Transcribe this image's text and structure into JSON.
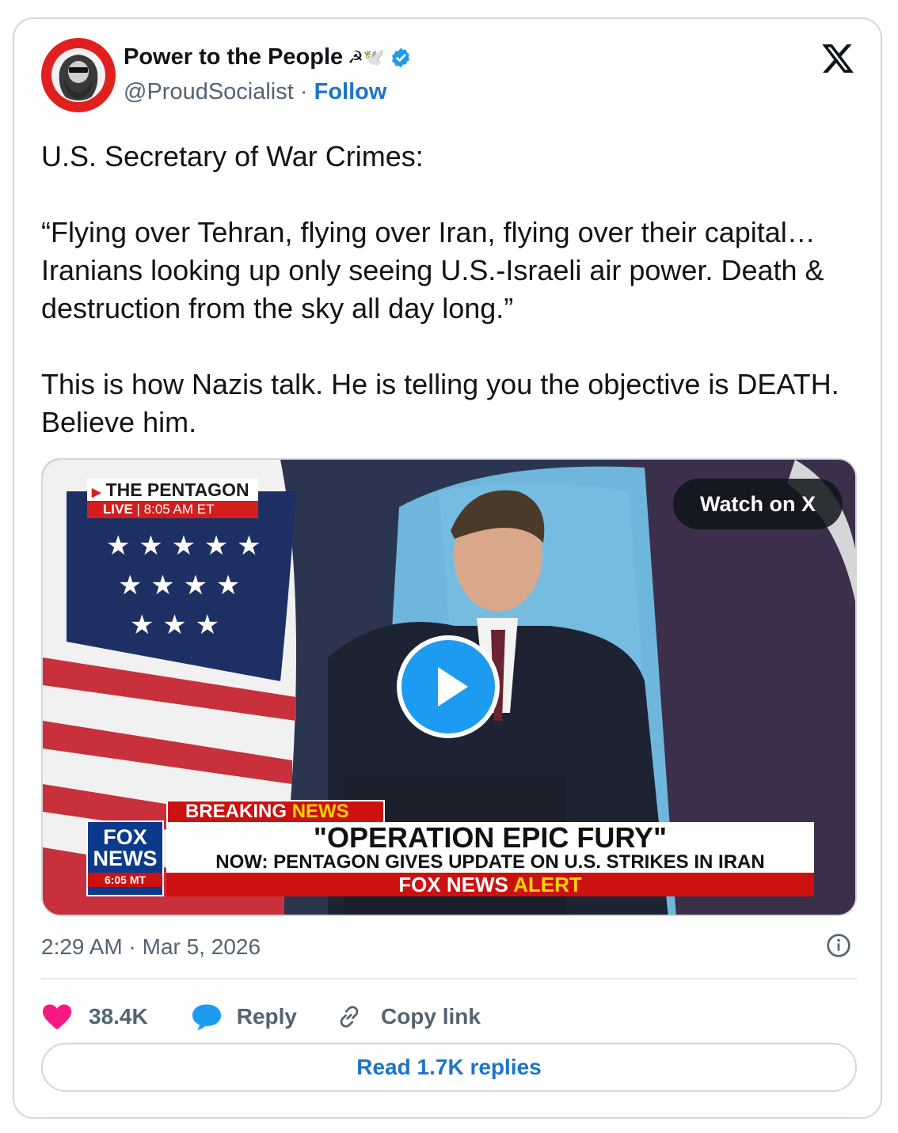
{
  "author": {
    "display_name": "Power to the People",
    "name_emoji": "☭🕊️",
    "verified": true,
    "handle": "@ProudSocialist",
    "separator": "·",
    "follow_label": "Follow"
  },
  "post": {
    "paragraphs": [
      "U.S. Secretary of War Crimes:",
      "“Flying over Tehran, flying over Iran, flying over their capital…Iranians looking up only seeing U.S.-Israeli air power. Death & destruction from the sky all day long.”",
      "This is how Nazis talk. He is telling you the objective is DEATH. Believe him."
    ],
    "timestamp": "2:29 AM · Mar 5, 2026"
  },
  "video": {
    "watch_label": "Watch on X",
    "chyron": {
      "source": "THE PENTAGON",
      "live": "LIVE",
      "live_time": "8:05 AM ET",
      "network_top": "FOX",
      "network_bottom": "NEWS",
      "network_time": "6:05 MT",
      "breaking": "BREAKING",
      "breaking_news": "NEWS",
      "headline": "\"OPERATION EPIC FURY\"",
      "subheadline": "NOW: PENTAGON GIVES UPDATE ON U.S. STRIKES IN IRAN",
      "alert_fox": "FOX NEWS",
      "alert_word": "ALERT"
    }
  },
  "actions": {
    "likes": "38.4K",
    "reply_label": "Reply",
    "copy_link_label": "Copy link",
    "read_replies_label": "Read 1.7K replies"
  },
  "colors": {
    "like": "#f91880",
    "reply": "#1d9bf0",
    "link": "#1d74c8",
    "play": "#1d9bf0",
    "border": "#cfd9de"
  }
}
